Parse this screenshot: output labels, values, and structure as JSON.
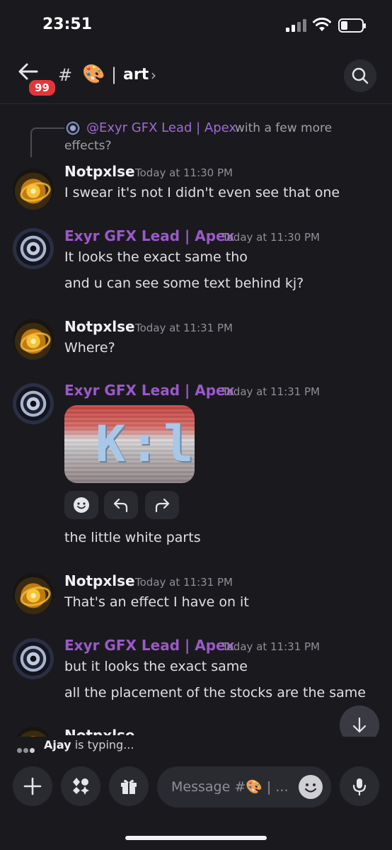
{
  "status": {
    "time": "23:51"
  },
  "header": {
    "badge": "99",
    "hash": "#",
    "emoji": "🎨",
    "separator": "|",
    "channel": "art",
    "chevron": "›"
  },
  "reply": {
    "mention": "@Exyr GFX Lead | Apex",
    "text_part1": "with a few more",
    "text_part2": "effects?"
  },
  "messages": [
    {
      "author": "Notpxlse",
      "time": "Today at 11:30 PM",
      "lines": [
        "I swear it's not I didn't even see that one"
      ]
    },
    {
      "author": "Exyr GFX Lead | Apex",
      "time": "Today at 11:30 PM",
      "lines": [
        "It looks the exact same tho",
        "and u can see some text behind kj?"
      ]
    },
    {
      "author": "Notpxlse",
      "time": "Today at 11:31 PM",
      "lines": [
        "Where?"
      ]
    },
    {
      "author": "Exyr GFX Lead | Apex",
      "time": "Today at 11:31 PM",
      "attachment_text": "K:l",
      "lines": [
        "the little white parts"
      ]
    },
    {
      "author": "Notpxlse",
      "time": "Today at 11:31 PM",
      "lines": [
        "That's an effect I have on it"
      ]
    },
    {
      "author": "Exyr GFX Lead | Apex",
      "time": "Today at 11:31 PM",
      "lines": [
        "but it looks the exact same",
        "all the placement of the stocks are the same"
      ]
    }
  ],
  "partial_author": "Notpxlse",
  "typing": {
    "user": "Ajay",
    "suffix": " is typing..."
  },
  "composer": {
    "placeholder": "Message #🎨 | ..."
  },
  "colors": {
    "background": "#1a1a1e",
    "purple_name": "#9b59c9",
    "badge": "#e5353a"
  }
}
